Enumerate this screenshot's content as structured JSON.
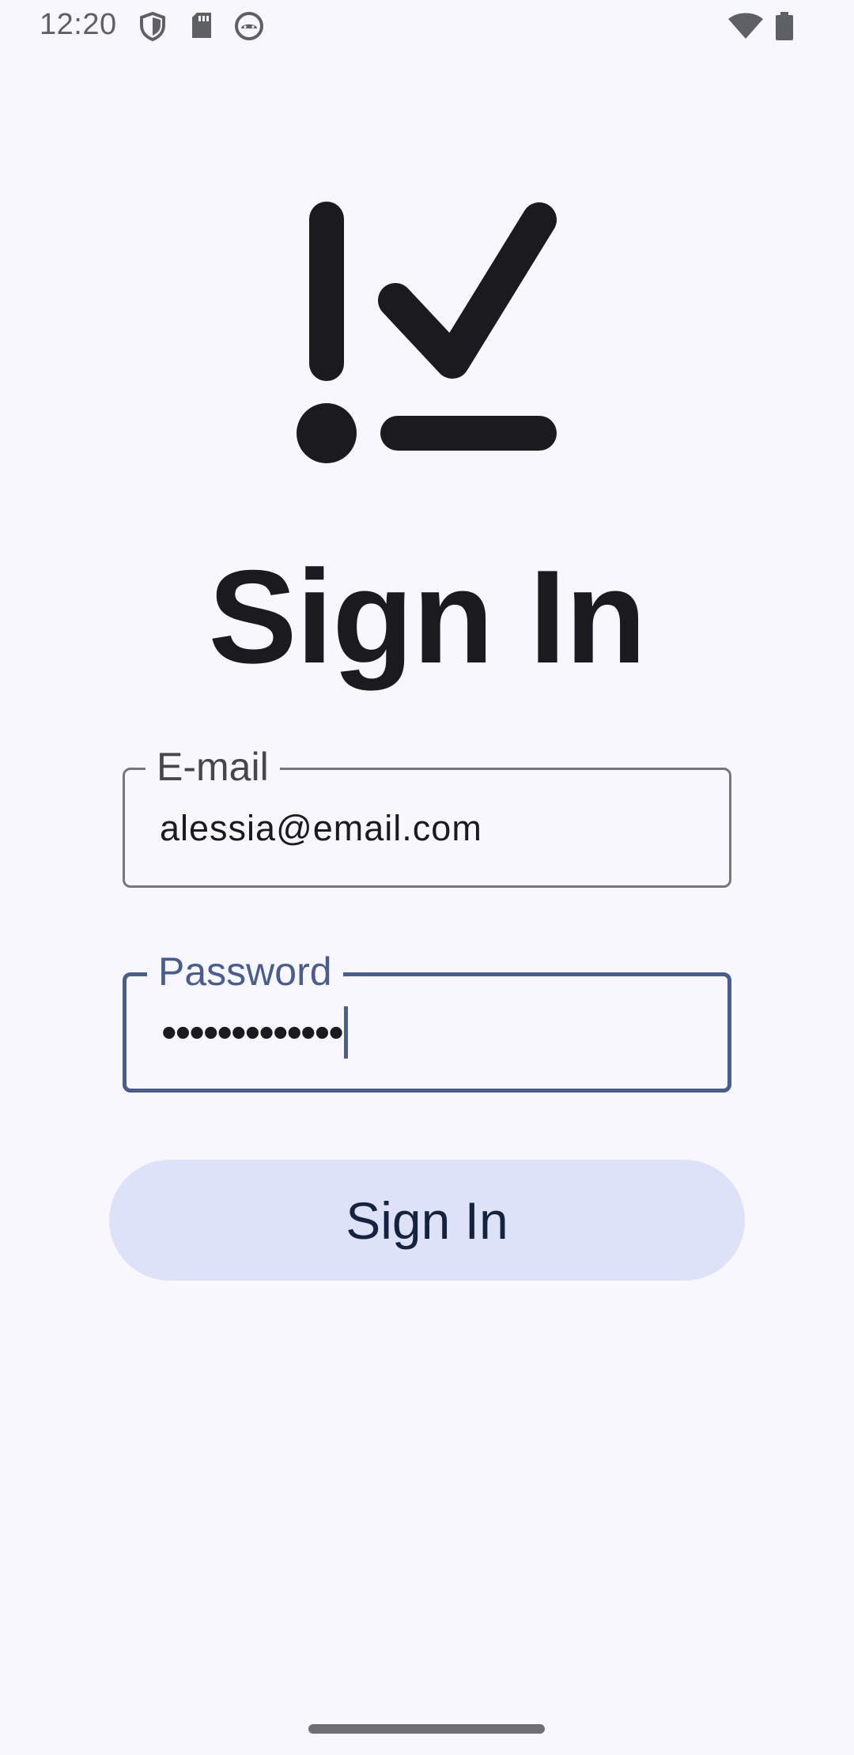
{
  "status_bar": {
    "time": "12:20",
    "icons": [
      "shield-icon",
      "sd-card-icon",
      "android-debug-icon",
      "wifi-icon",
      "battery-icon"
    ]
  },
  "logo": {
    "icon": "checklist-logo-icon"
  },
  "page": {
    "title": "Sign In"
  },
  "form": {
    "email": {
      "label": "E-mail",
      "value": "alessia@email.com"
    },
    "password": {
      "label": "Password",
      "masked_value": "•••••••••••••"
    },
    "submit_label": "Sign In"
  },
  "colors": {
    "background": "#f8f7fd",
    "primary": "#4a5d8f",
    "button_bg": "#dde2f8",
    "text": "#1b1b1f"
  }
}
